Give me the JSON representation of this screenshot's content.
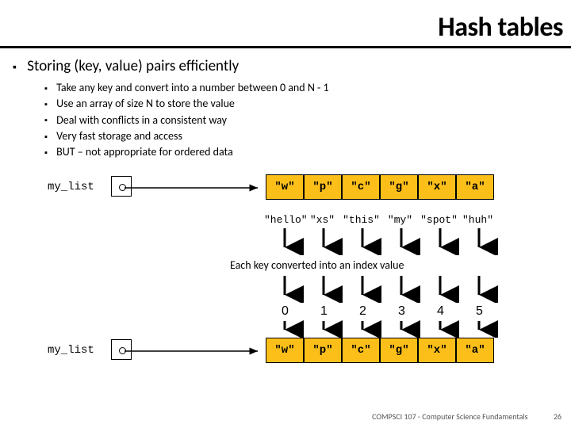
{
  "title": "Hash tables",
  "main_point": "Storing (key, value) pairs efficiently",
  "sub_points": [
    "Take any key and convert into a number between 0 and N - 1",
    "Use an array of size N to store the value",
    "Deal with conflicts in a consistent way",
    "Very fast storage and access",
    "BUT – not appropriate for ordered data"
  ],
  "diagram": {
    "var_name": "my_list",
    "cells": [
      "\"w\"",
      "\"p\"",
      "\"c\"",
      "\"g\"",
      "\"x\"",
      "\"a\""
    ],
    "keys": [
      "\"hello\"",
      "\"xs\"",
      "\"this\"",
      "\"my\"",
      "\"spot\"",
      "\"huh\""
    ],
    "indices": [
      "0",
      "1",
      "2",
      "3",
      "4",
      "5"
    ],
    "caption": "Each key converted into an index value"
  },
  "footer": {
    "course": "COMPSCI 107 - Computer Science Fundamentals",
    "page": "26"
  }
}
